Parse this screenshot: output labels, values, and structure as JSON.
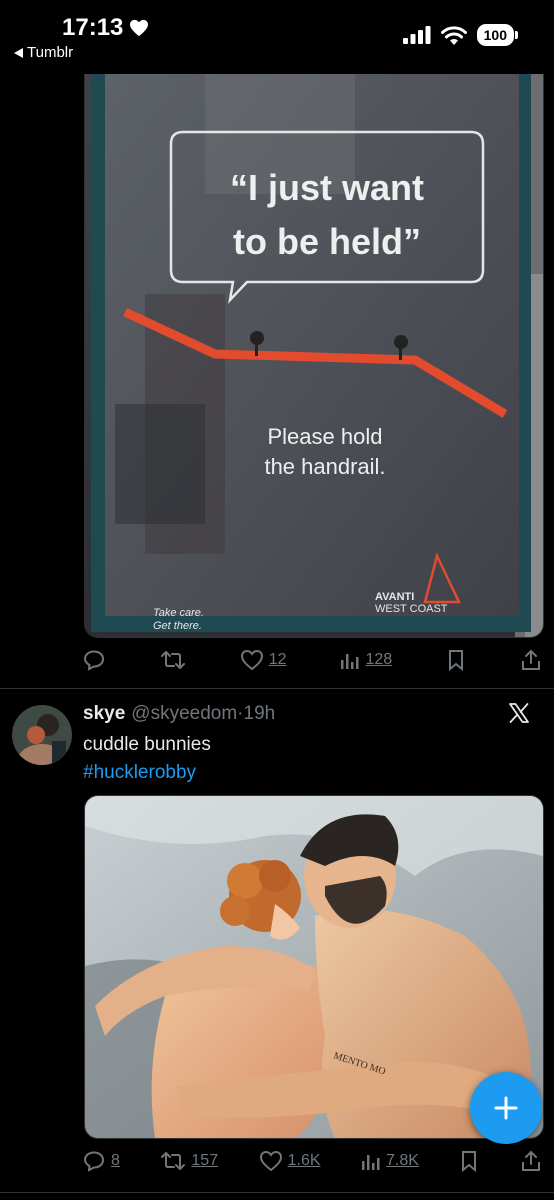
{
  "status_bar": {
    "time": "17:13",
    "back_label": "Tumblr",
    "battery": "100"
  },
  "post1": {
    "poster": {
      "quote_line1": "“I just want",
      "quote_line2": "to be held”",
      "message_line1": "Please hold",
      "message_line2": "the handrail.",
      "brand_line1": "AVANTI",
      "brand_line2": "WEST COAST",
      "tagline_line1": "Take care.",
      "tagline_line2": "Get there."
    },
    "actions": {
      "likes": "12",
      "views": "128"
    }
  },
  "post2": {
    "name": "skye",
    "handle": "@skyeedom",
    "separator": "·",
    "time": "19h",
    "text": "cuddle bunnies",
    "hashtag": "#hucklerobby",
    "tattoo_text": "MENTO MO",
    "actions": {
      "replies": "8",
      "reposts": "157",
      "likes": "1.6K",
      "views": "7.8K"
    }
  },
  "icons": {
    "reply": "reply-icon",
    "repost": "repost-icon",
    "like": "heart-icon",
    "views": "views-icon",
    "bookmark": "bookmark-icon",
    "share": "share-icon",
    "fab": "plus-icon",
    "platform": "x-logo-icon"
  },
  "colors": {
    "background": "#000000",
    "accent": "#1d9bf0",
    "muted": "#71767b",
    "text": "#e7e9ea"
  }
}
